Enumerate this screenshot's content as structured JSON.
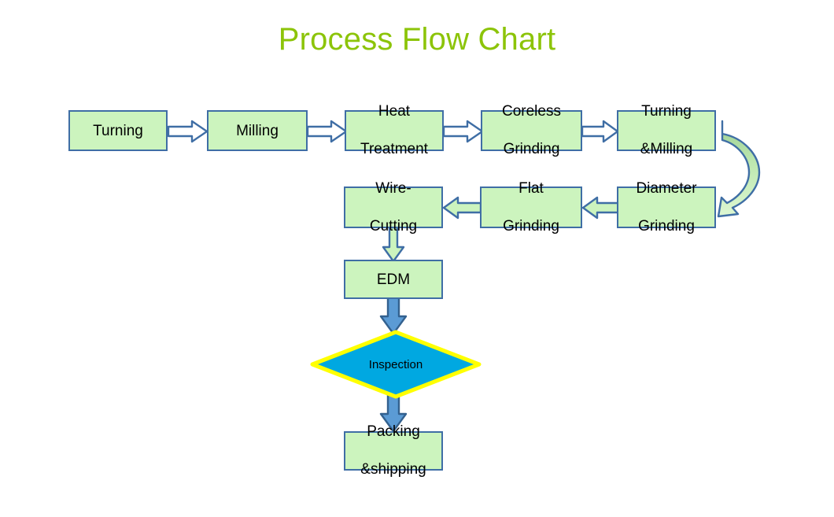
{
  "page": {
    "title": "Process Flow Chart",
    "title_color": "#8CC409",
    "background": "#FFFFFF"
  },
  "palette": {
    "node_fill": "#CCF4BE",
    "node_border": "#3F6EA5",
    "node_text": "#000000",
    "arrow_outline_fill": "#FFFFFF",
    "arrow_green_fill": "#CCF4BE",
    "arrow_blue_fill": "#5B9BD5",
    "arrow_stroke": "#3F6EA5",
    "decision_fill": "#00A8E1",
    "decision_border": "#FFFF00",
    "decision_text": "#000000",
    "curve_fill": "#9FD89F"
  },
  "flow": {
    "rows": [
      {
        "name": "row-1",
        "nodes": [
          {
            "id": "turning",
            "label": "Turning",
            "lines": [
              "Turning"
            ]
          },
          {
            "id": "milling",
            "label": "Milling",
            "lines": [
              "Milling"
            ]
          },
          {
            "id": "heat-treatment",
            "label": "Heat Treatment",
            "lines": [
              "Heat",
              "Treatment"
            ]
          },
          {
            "id": "coreless-grinding",
            "label": "Coreless Grinding",
            "lines": [
              "Coreless",
              "Grinding"
            ]
          },
          {
            "id": "turning-milling",
            "label": "Turning &Milling",
            "lines": [
              "Turning",
              "&Milling"
            ]
          }
        ]
      },
      {
        "name": "row-2",
        "nodes": [
          {
            "id": "wire-cutting",
            "label": "Wire-Cutting",
            "lines": [
              "Wire-",
              "Cutting"
            ]
          },
          {
            "id": "flat-grinding",
            "label": "Flat Grinding",
            "lines": [
              "Flat",
              "Grinding"
            ]
          },
          {
            "id": "diameter-grinding",
            "label": "Diameter Grinding",
            "lines": [
              "Diameter",
              "Grinding"
            ]
          }
        ]
      },
      {
        "name": "row-3",
        "nodes": [
          {
            "id": "edm",
            "label": "EDM",
            "lines": [
              "EDM"
            ]
          }
        ]
      },
      {
        "name": "row-4",
        "nodes": [
          {
            "id": "inspection",
            "label": "Inspection",
            "shape": "diamond"
          }
        ]
      },
      {
        "name": "row-5",
        "nodes": [
          {
            "id": "packing-shipping",
            "label": "Packing &shipping",
            "lines": [
              "Packing",
              "&shipping"
            ]
          }
        ]
      }
    ],
    "connectors": [
      {
        "id": "turning-to-milling",
        "from": "turning",
        "to": "milling",
        "direction": "right",
        "style": "outline"
      },
      {
        "id": "milling-to-heat-treatment",
        "from": "milling",
        "to": "heat-treatment",
        "direction": "right",
        "style": "outline"
      },
      {
        "id": "heat-treatment-to-coreless-grinding",
        "from": "heat-treatment",
        "to": "coreless-grinding",
        "direction": "right",
        "style": "outline"
      },
      {
        "id": "coreless-grinding-to-turning-milling",
        "from": "coreless-grinding",
        "to": "turning-milling",
        "direction": "right",
        "style": "outline"
      },
      {
        "id": "turning-milling-to-diameter-grinding",
        "from": "turning-milling",
        "to": "diameter-grinding",
        "direction": "curved-down",
        "style": "curve"
      },
      {
        "id": "diameter-grinding-to-flat-grinding",
        "from": "diameter-grinding",
        "to": "flat-grinding",
        "direction": "left",
        "style": "green"
      },
      {
        "id": "flat-grinding-to-wire-cutting",
        "from": "flat-grinding",
        "to": "wire-cutting",
        "direction": "left",
        "style": "green"
      },
      {
        "id": "wire-cutting-to-edm",
        "from": "wire-cutting",
        "to": "edm",
        "direction": "down",
        "style": "green"
      },
      {
        "id": "edm-to-inspection",
        "from": "edm",
        "to": "inspection",
        "direction": "down",
        "style": "blue"
      },
      {
        "id": "inspection-to-packing-shipping",
        "from": "inspection",
        "to": "packing-shipping",
        "direction": "down",
        "style": "blue"
      }
    ]
  }
}
